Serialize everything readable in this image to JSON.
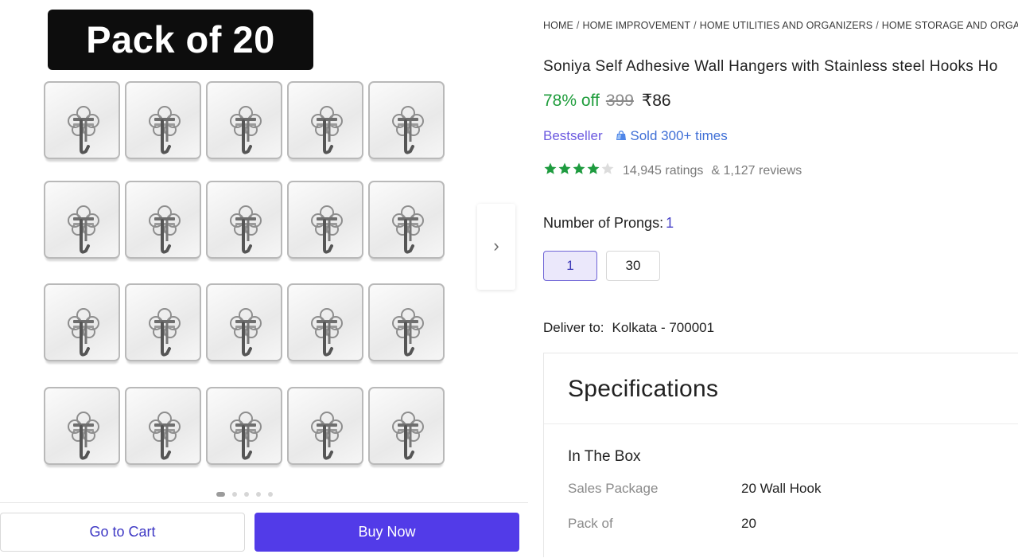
{
  "gallery": {
    "badge_text": "Pack of 20",
    "hook_count": 20,
    "image_count": 5,
    "active_image_index": 1
  },
  "breadcrumb": [
    "HOME",
    "HOME IMPROVEMENT",
    "HOME UTILITIES AND ORGANIZERS",
    "HOME STORAGE AND ORGANIZA"
  ],
  "product": {
    "title": "Soniya Self Adhesive Wall Hangers with Stainless steel Hooks Ho",
    "discount": "78% off",
    "mrp": "399",
    "price": "₹86",
    "bestseller": "Bestseller",
    "sold": "Sold 300+ times",
    "rating_value": 4,
    "rating_max": 5,
    "ratings": "14,945 ratings",
    "reviews": "& 1,127 reviews"
  },
  "variant": {
    "label": "Number of Prongs:",
    "selected": "1",
    "options": [
      "1",
      "30"
    ]
  },
  "delivery": {
    "label": "Deliver to:",
    "location": "Kolkata - 700001"
  },
  "specifications": {
    "title": "Specifications",
    "group": "In The Box",
    "rows": [
      {
        "key": "Sales Package",
        "value": "20 Wall Hook"
      },
      {
        "key": "Pack of",
        "value": "20"
      }
    ]
  },
  "actions": {
    "cart": "Go to Cart",
    "buy": "Buy Now"
  },
  "colors": {
    "accent": "#523be8",
    "discount_green": "#1f9d3c",
    "star_green": "#1e9b3f"
  },
  "icons": {
    "next": "chevron-right-icon",
    "sold": "shopping-bag-icon",
    "star": "star-icon"
  }
}
